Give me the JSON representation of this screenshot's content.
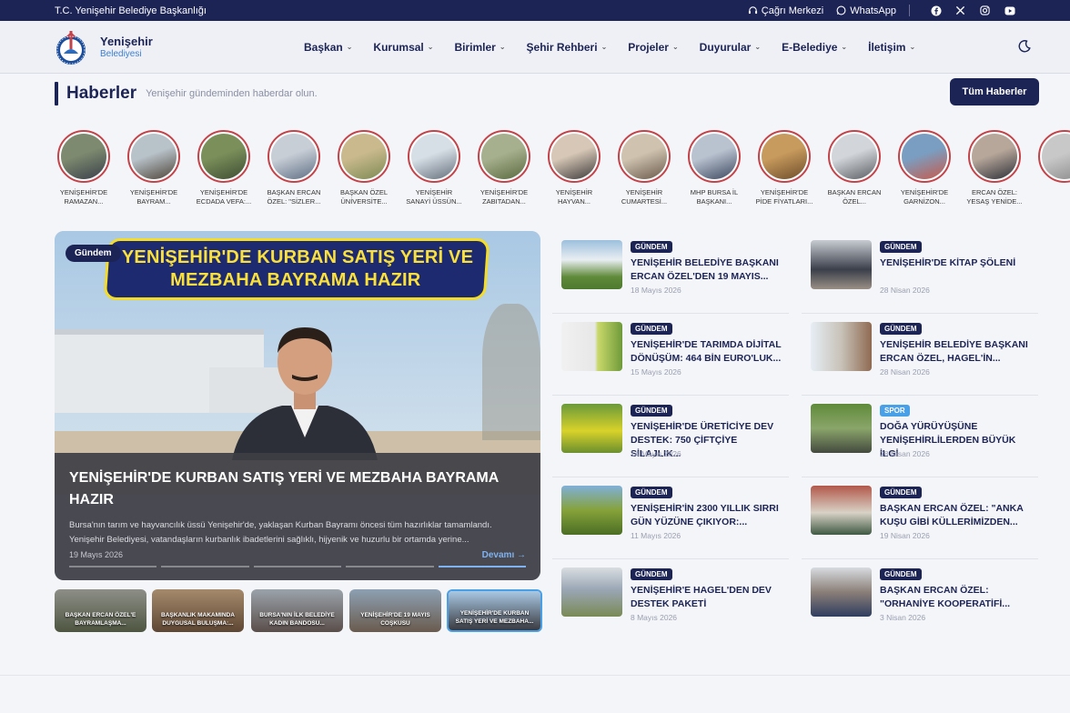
{
  "topbar": {
    "org": "T.C. Yenişehir Belediye Başkanlığı",
    "call_center": "Çağrı Merkezi",
    "whatsapp": "WhatsApp"
  },
  "header": {
    "logo_line1": "Yenişehir",
    "logo_line2": "Belediyesi",
    "nav": [
      {
        "label": "Başkan"
      },
      {
        "label": "Kurumsal"
      },
      {
        "label": "Birimler"
      },
      {
        "label": "Şehir Rehberi"
      },
      {
        "label": "Projeler"
      },
      {
        "label": "Duyurular"
      },
      {
        "label": "E-Belediye"
      },
      {
        "label": "İletişim"
      }
    ]
  },
  "section": {
    "title": "Haberler",
    "subtitle": "Yenişehir gündeminden haberdar olun.",
    "all_button": "Tüm Haberler"
  },
  "stories": [
    {
      "line1": "YENİŞEHİR'DE",
      "line2": "RAMAZAN..."
    },
    {
      "line1": "YENİŞEHİR'DE",
      "line2": "BAYRAM..."
    },
    {
      "line1": "YENİŞEHİR'DE",
      "line2": "ECDADA VEFA:..."
    },
    {
      "line1": "BAŞKAN ERCAN",
      "line2": "ÖZEL: \"SİZLER..."
    },
    {
      "line1": "BAŞKAN ÖZEL",
      "line2": "ÜNİVERSİTE..."
    },
    {
      "line1": "YENİŞEHİR",
      "line2": "SANAYİ ÜSSÜN..."
    },
    {
      "line1": "YENİŞEHİR'DE",
      "line2": "ZABITADAN..."
    },
    {
      "line1": "YENİŞEHİR",
      "line2": "HAYVAN..."
    },
    {
      "line1": "YENİŞEHİR",
      "line2": "CUMARTESİ..."
    },
    {
      "line1": "MHP BURSA İL",
      "line2": "BAŞKANI..."
    },
    {
      "line1": "YENİŞEHİR'DE",
      "line2": "PİDE FİYATLARI..."
    },
    {
      "line1": "BAŞKAN ERCAN",
      "line2": "ÖZEL..."
    },
    {
      "line1": "YENİŞEHİR'DE",
      "line2": "GARNİZON..."
    },
    {
      "line1": "ERCAN ÖZEL:",
      "line2": "YESAŞ YENİDE..."
    }
  ],
  "featured": {
    "category": "Gündem",
    "banner_line1": "YENİŞEHİR'DE KURBAN SATIŞ YERİ VE",
    "banner_line2": "MEZBAHA BAYRAMA HAZIR",
    "title": "YENİŞEHİR'DE KURBAN SATIŞ YERİ VE MEZBAHA BAYRAMA HAZIR",
    "description": "Bursa'nın tarım ve hayvancılık üssü Yenişehir'de, yaklaşan Kurban Bayramı öncesi tüm hazırlıklar tamamlandı. Yenişehir Belediyesi, vatandaşların kurbanlık ibadetlerini sağlıklı, hijyenik ve huzurlu bir ortamda yerine...",
    "date": "19 Mayıs 2026",
    "more": "Devamı →",
    "progress_active_index": 4
  },
  "thumbs": [
    {
      "label": "BAŞKAN ERCAN ÖZEL'E BAYRAMLAŞMA..."
    },
    {
      "label": "BAŞKANLIK MAKAMINDA DUYGUSAL BULUŞMA:..."
    },
    {
      "label": "BURSA'NIN İLK BELEDİYE KADIN BANDOSU..."
    },
    {
      "label": "YENİŞEHİR'DE 19 MAYIS COŞKUSU"
    },
    {
      "label": "YENİŞEHİR'DE KURBAN SATIŞ YERİ VE MEZBAHA..."
    }
  ],
  "news_left": [
    {
      "category": "GÜNDEM",
      "title": "YENİŞEHİR BELEDİYE BAŞKANI ERCAN ÖZEL'DEN 19 MAYIS...",
      "date": "18 Mayıs 2026"
    },
    {
      "category": "GÜNDEM",
      "title": "YENİŞEHİR'DE TARIMDA DİJİTAL DÖNÜŞÜM: 464 BİN EURO'LUK...",
      "date": "15 Mayıs 2026"
    },
    {
      "category": "GÜNDEM",
      "title": "YENİŞEHİR'DE ÜRETİCİYE DEV DESTEK: 750 ÇİFTÇİYE SİLAJLIK...",
      "date": "14 Mayıs 2026"
    },
    {
      "category": "GÜNDEM",
      "title": "YENİŞEHİR'İN 2300 YILLIK SIRRI GÜN YÜZÜNE ÇIKIYOR:...",
      "date": "11 Mayıs 2026"
    },
    {
      "category": "GÜNDEM",
      "title": "YENİŞEHİR'E HAGEL'DEN DEV DESTEK PAKETİ",
      "date": "8 Mayıs 2026"
    }
  ],
  "news_right": [
    {
      "category": "GÜNDEM",
      "title": "YENİŞEHİR'DE KİTAP ŞÖLENİ",
      "date": "28 Nisan 2026"
    },
    {
      "category": "GÜNDEM",
      "title": "YENİŞEHİR BELEDİYE BAŞKANI ERCAN ÖZEL, HAGEL'İN...",
      "date": "28 Nisan 2026"
    },
    {
      "category": "SPOR",
      "title": "DOĞA YÜRÜYÜŞÜNE YENİŞEHİRLİLERDEN BÜYÜK İLGİ",
      "date": "28 Nisan 2026"
    },
    {
      "category": "GÜNDEM",
      "title": "BAŞKAN ERCAN ÖZEL: \"ANKA KUŞU GİBİ KÜLLERİMİZDEN...",
      "date": "19 Nisan 2026"
    },
    {
      "category": "GÜNDEM",
      "title": "BAŞKAN ERCAN ÖZEL: \"ORHANİYE KOOPERATİFİ...",
      "date": "3 Nisan 2026"
    }
  ],
  "colors": {
    "primary": "#1c2456",
    "accent": "#4aa0e6",
    "story_ring": "#c2444a",
    "banner_yellow": "#f4dc27"
  }
}
